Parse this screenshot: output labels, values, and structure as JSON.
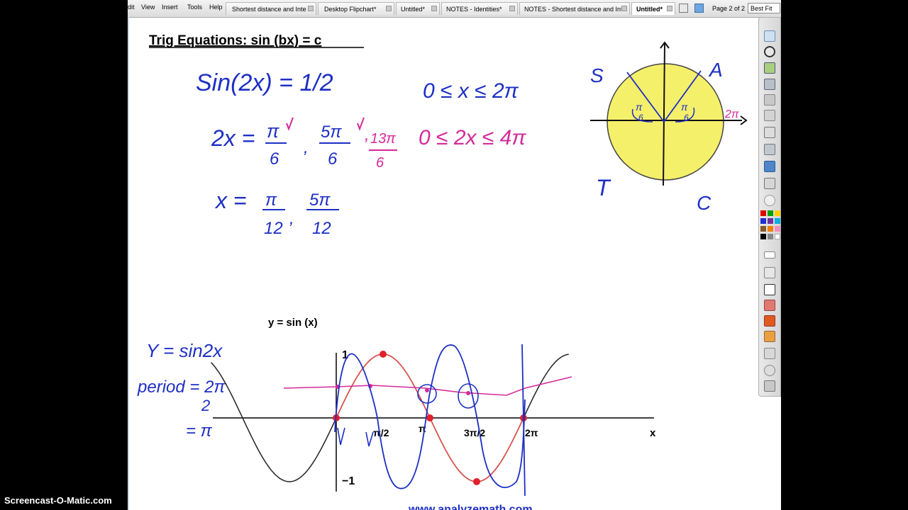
{
  "menu": [
    "dit",
    "View",
    "Insert",
    "Tools",
    "Help"
  ],
  "tabs": [
    {
      "label": "Shortest distance and Inte",
      "active": false
    },
    {
      "label": "Desktop Flipchart*",
      "active": false
    },
    {
      "label": "Untitled*",
      "active": false
    },
    {
      "label": "NOTES - Identities*",
      "active": false
    },
    {
      "label": "NOTES - Shortest distance and Inte",
      "active": false
    },
    {
      "label": "Untitled*",
      "active": true
    }
  ],
  "page_indicator": "Page 2 of 2",
  "zoom": "Best Fit",
  "notes": {
    "title": "Trig Equations:  sin (bx) = c",
    "eq1": "Sin(2x) = 1/2",
    "domain1": "0 ≤ x ≤ 2π",
    "eq2_lhs": "2x =",
    "eq2_f1": {
      "num": "π",
      "den": "6"
    },
    "eq2_f2": {
      "num": "5π",
      "den": "6"
    },
    "eq2_f3": {
      "num": "13π",
      "den": "6"
    },
    "domain2": "0 ≤ 2x ≤ 4π",
    "eq3_lhs": "x =",
    "eq3_f1": {
      "num": "π",
      "den": "12"
    },
    "eq3_f2": {
      "num": "5π",
      "den": "12"
    },
    "side_y": "Y = sin2x",
    "side_period": "period = 2π",
    "side_period_den": "2",
    "side_result": "= π"
  },
  "circle": {
    "fill": "#f5f06a",
    "quadrants": [
      "S",
      "A",
      "T",
      "C"
    ],
    "angle_label": "π/6",
    "angle_num": "π",
    "angle_den": "6",
    "axis_label": "2π"
  },
  "graph": {
    "title": "y = sin (x)",
    "y_ticks": [
      "1",
      "−1"
    ],
    "x_ticks": [
      "π/2",
      "π",
      "3π/2",
      "2π"
    ],
    "x_label": "x",
    "footer": "www.analyzemath.com"
  },
  "watermark": "Screencast-O-Matic.com",
  "colors": {
    "ink_blue": "#1d2fc4",
    "ink_pink": "#d42a9a",
    "ink_red": "#e0202a",
    "curve_red": "#e0504a"
  }
}
